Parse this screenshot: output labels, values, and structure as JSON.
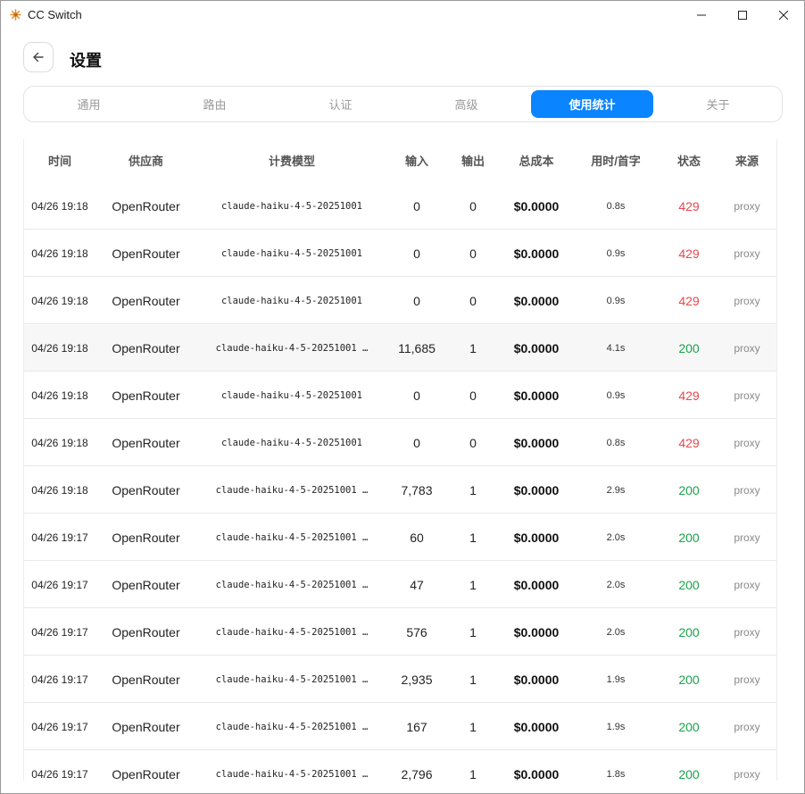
{
  "window": {
    "title": "CC Switch",
    "minimize": "─",
    "maximize": "☐",
    "close": "✕"
  },
  "header": {
    "title": "设置",
    "back_icon": "arrow-left-icon"
  },
  "tabs": [
    {
      "label": "通用",
      "active": false
    },
    {
      "label": "路由",
      "active": false
    },
    {
      "label": "认证",
      "active": false
    },
    {
      "label": "高级",
      "active": false
    },
    {
      "label": "使用统计",
      "active": true
    },
    {
      "label": "关于",
      "active": false
    }
  ],
  "colors": {
    "accent": "#0a84ff",
    "success": "#1aa34a",
    "error": "#e5484d"
  },
  "table": {
    "columns": [
      "时间",
      "供应商",
      "计费模型",
      "输入",
      "输出",
      "总成本",
      "用时/首字",
      "状态",
      "来源"
    ],
    "rows": [
      {
        "time": "04/26 19:18",
        "provider": "OpenRouter",
        "model": "claude-haiku-4-5-20251001",
        "input": "0",
        "output": "0",
        "cost": "$0.0000",
        "duration": "0.8s",
        "status": "429",
        "source": "proxy"
      },
      {
        "time": "04/26 19:18",
        "provider": "OpenRouter",
        "model": "claude-haiku-4-5-20251001",
        "input": "0",
        "output": "0",
        "cost": "$0.0000",
        "duration": "0.9s",
        "status": "429",
        "source": "proxy"
      },
      {
        "time": "04/26 19:18",
        "provider": "OpenRouter",
        "model": "claude-haiku-4-5-20251001",
        "input": "0",
        "output": "0",
        "cost": "$0.0000",
        "duration": "0.9s",
        "status": "429",
        "source": "proxy"
      },
      {
        "time": "04/26 19:18",
        "provider": "OpenRouter",
        "model": "claude-haiku-4-5-20251001 …",
        "input": "11,685",
        "output": "1",
        "cost": "$0.0000",
        "duration": "4.1s",
        "status": "200",
        "source": "proxy"
      },
      {
        "time": "04/26 19:18",
        "provider": "OpenRouter",
        "model": "claude-haiku-4-5-20251001",
        "input": "0",
        "output": "0",
        "cost": "$0.0000",
        "duration": "0.9s",
        "status": "429",
        "source": "proxy"
      },
      {
        "time": "04/26 19:18",
        "provider": "OpenRouter",
        "model": "claude-haiku-4-5-20251001",
        "input": "0",
        "output": "0",
        "cost": "$0.0000",
        "duration": "0.8s",
        "status": "429",
        "source": "proxy"
      },
      {
        "time": "04/26 19:18",
        "provider": "OpenRouter",
        "model": "claude-haiku-4-5-20251001 …",
        "input": "7,783",
        "output": "1",
        "cost": "$0.0000",
        "duration": "2.9s",
        "status": "200",
        "source": "proxy"
      },
      {
        "time": "04/26 19:17",
        "provider": "OpenRouter",
        "model": "claude-haiku-4-5-20251001 …",
        "input": "60",
        "output": "1",
        "cost": "$0.0000",
        "duration": "2.0s",
        "status": "200",
        "source": "proxy"
      },
      {
        "time": "04/26 19:17",
        "provider": "OpenRouter",
        "model": "claude-haiku-4-5-20251001 …",
        "input": "47",
        "output": "1",
        "cost": "$0.0000",
        "duration": "2.0s",
        "status": "200",
        "source": "proxy"
      },
      {
        "time": "04/26 19:17",
        "provider": "OpenRouter",
        "model": "claude-haiku-4-5-20251001 …",
        "input": "576",
        "output": "1",
        "cost": "$0.0000",
        "duration": "2.0s",
        "status": "200",
        "source": "proxy"
      },
      {
        "time": "04/26 19:17",
        "provider": "OpenRouter",
        "model": "claude-haiku-4-5-20251001 …",
        "input": "2,935",
        "output": "1",
        "cost": "$0.0000",
        "duration": "1.9s",
        "status": "200",
        "source": "proxy"
      },
      {
        "time": "04/26 19:17",
        "provider": "OpenRouter",
        "model": "claude-haiku-4-5-20251001 …",
        "input": "167",
        "output": "1",
        "cost": "$0.0000",
        "duration": "1.9s",
        "status": "200",
        "source": "proxy"
      },
      {
        "time": "04/26 19:17",
        "provider": "OpenRouter",
        "model": "claude-haiku-4-5-20251001 …",
        "input": "2,796",
        "output": "1",
        "cost": "$0.0000",
        "duration": "1.8s",
        "status": "200",
        "source": "proxy"
      }
    ]
  }
}
